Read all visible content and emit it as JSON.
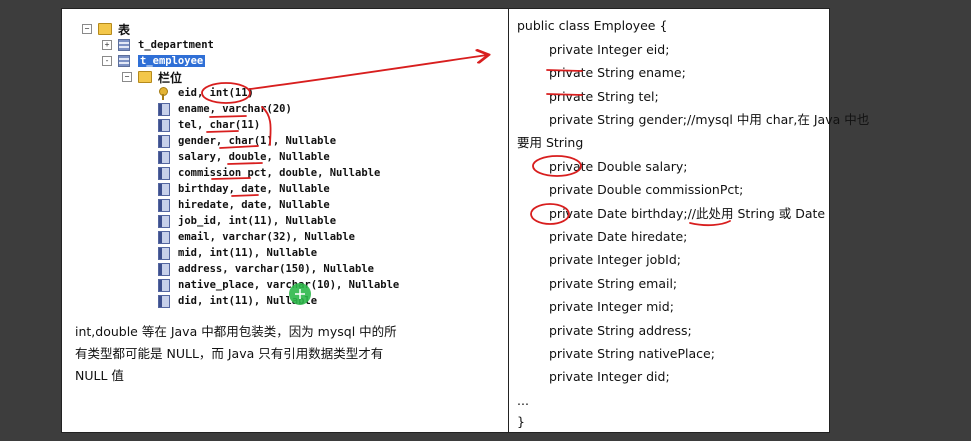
{
  "tree": {
    "root_label": "表",
    "tables": [
      {
        "label": "t_department",
        "expander": "+"
      },
      {
        "label": "t_employee",
        "expander": "-"
      }
    ],
    "columns_folder_label": "栏位",
    "columns": [
      "eid, int(11)",
      "ename, varchar(20)",
      "tel, char(11)",
      "gender, char(1), Nullable",
      "salary, double, Nullable",
      "commission_pct, double, Nullable",
      "birthday, date, Nullable",
      "hiredate, date, Nullable",
      "job_id, int(11), Nullable",
      "email, varchar(32), Nullable",
      "mid, int(11), Nullable",
      "address, varchar(150), Nullable",
      "native_place, varchar(10), Nullable",
      "did, int(11), Nullable"
    ]
  },
  "note": {
    "line1": "int,double 等在 Java 中都用包装类，因为 mysql 中的所",
    "line2": "有类型都可能是 NULL，而 Java 只有引用数据类型才有",
    "line3": "NULL 值"
  },
  "code": {
    "lines": [
      "public class Employee {",
      "private Integer eid;",
      "private String ename;",
      "private String tel;",
      "private String gender;//mysql 中用 char,在 Java 中也",
      "要用 String",
      "private Double salary;",
      "private Double commissionPct;",
      "private Date birthday;//此处用 String 或 Date",
      "private Date hiredate;",
      "private Integer jobId;",
      "private String email;",
      "private Integer mid;",
      "private String address;",
      "private String nativePlace;",
      "private Integer did;",
      "...",
      "}"
    ]
  },
  "colors": {
    "annotation": "#d81e1e",
    "cursor": "#2db84a",
    "selection": "#2f6fd6"
  }
}
